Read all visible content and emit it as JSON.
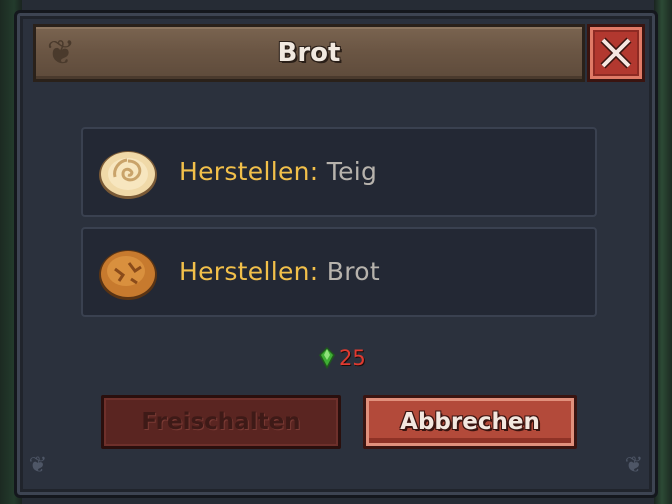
{
  "dialog": {
    "title": "Brot"
  },
  "recipes": [
    {
      "prefix": "Herstellen:",
      "item": "Teig",
      "icon": "dough-icon"
    },
    {
      "prefix": "Herstellen:",
      "item": "Brot",
      "icon": "bread-icon"
    }
  ],
  "cost": {
    "icon": "green-gem-icon",
    "amount": "25"
  },
  "buttons": {
    "unlock_label": "Freischalten",
    "cancel_label": "Abbrechen"
  },
  "colors": {
    "title_bar": "#6b5644",
    "label_accent": "#f2c04a",
    "item_text": "#b7b3ad",
    "cost_text": "#e03a30",
    "close_button": "#b2382f",
    "cancel_button": "#b34a3a",
    "unlock_button_disabled": "#5a2521"
  }
}
